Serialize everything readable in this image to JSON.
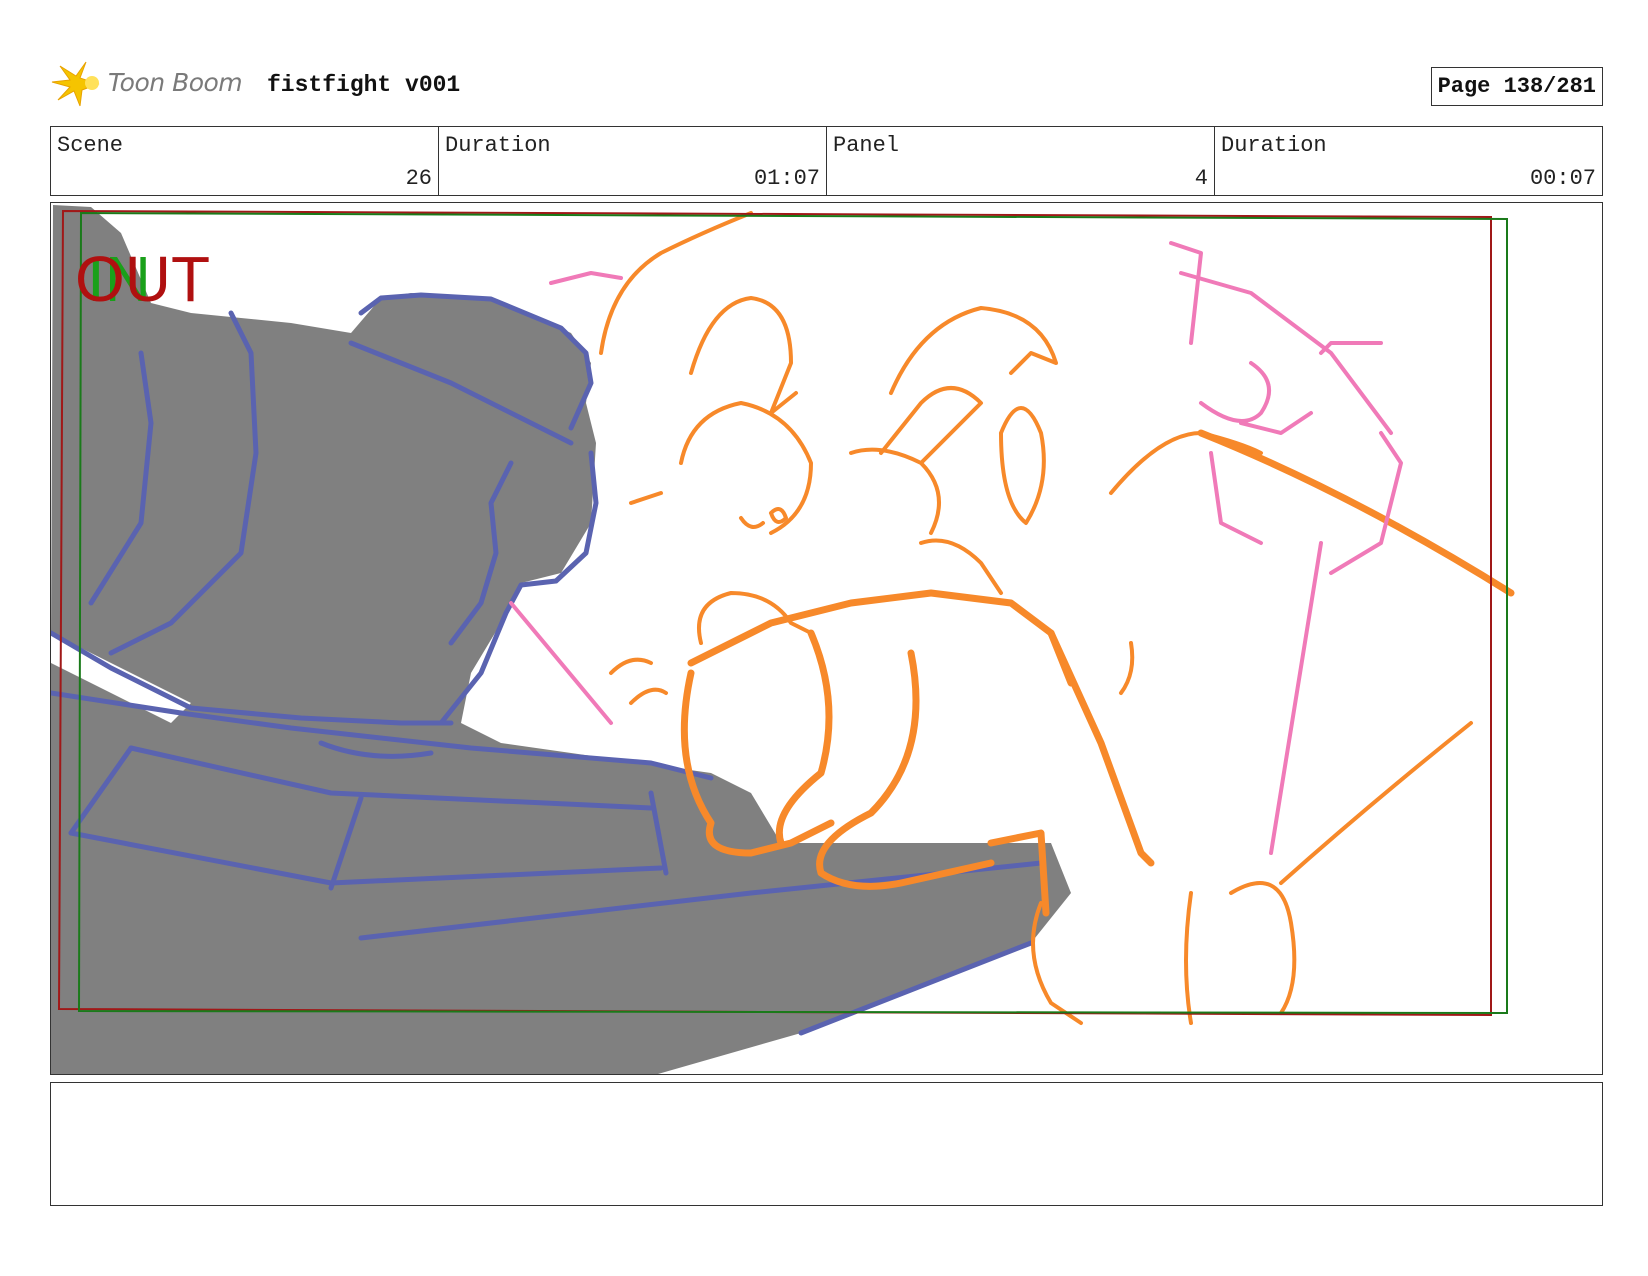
{
  "header": {
    "brand": "Toon Boom",
    "project_title": "fistfight v001",
    "page_label": "Page 138/281"
  },
  "info": {
    "scene_label": "Scene",
    "scene_value": "26",
    "scene_duration_label": "Duration",
    "scene_duration_value": "01:07",
    "panel_label": "Panel",
    "panel_value": "4",
    "panel_duration_label": "Duration",
    "panel_duration_value": "00:07"
  },
  "panel": {
    "out_label": "OUT",
    "in_label": "IN",
    "colors": {
      "background_shape": "#808080",
      "background_line": "#5a63b0",
      "character_line": "#f7892a",
      "pink_line": "#f07ab8",
      "safe_frame_red": "#a01818",
      "safe_frame_green": "#1a7a1a",
      "out_text": "#b01010",
      "in_text": "#1aa01a"
    }
  },
  "notes": {
    "text": ""
  }
}
